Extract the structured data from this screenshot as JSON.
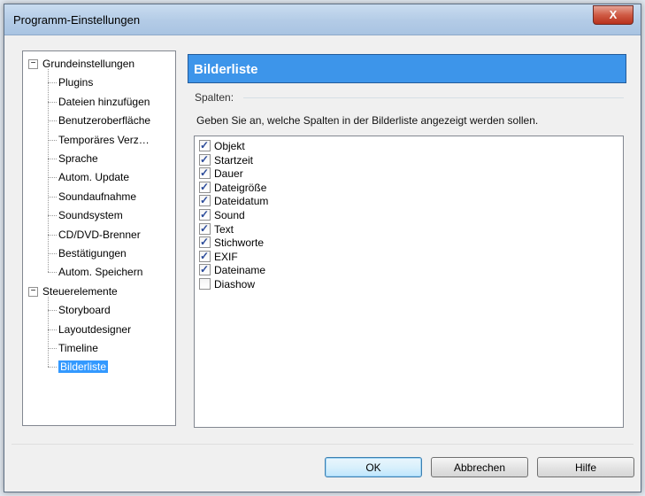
{
  "window": {
    "title": "Programm-Einstellungen",
    "close_glyph": "X"
  },
  "tree": {
    "items": [
      {
        "label": "Grundeinstellungen",
        "level": 0,
        "expander": "−",
        "selected": false
      },
      {
        "label": "Plugins",
        "level": 1,
        "selected": false
      },
      {
        "label": "Dateien hinzufügen",
        "level": 1,
        "selected": false
      },
      {
        "label": "Benutzeroberfläche",
        "level": 1,
        "selected": false
      },
      {
        "label": "Temporäres Verz…",
        "level": 1,
        "selected": false
      },
      {
        "label": "Sprache",
        "level": 1,
        "selected": false
      },
      {
        "label": "Autom. Update",
        "level": 1,
        "selected": false
      },
      {
        "label": "Soundaufnahme",
        "level": 1,
        "selected": false
      },
      {
        "label": "Soundsystem",
        "level": 1,
        "selected": false
      },
      {
        "label": "CD/DVD-Brenner",
        "level": 1,
        "selected": false
      },
      {
        "label": "Bestätigungen",
        "level": 1,
        "selected": false
      },
      {
        "label": "Autom. Speichern",
        "level": 1,
        "selected": false
      },
      {
        "label": "Steuerelemente",
        "level": 0,
        "expander": "−",
        "selected": false
      },
      {
        "label": "Storyboard",
        "level": 1,
        "selected": false
      },
      {
        "label": "Layoutdesigner",
        "level": 1,
        "selected": false
      },
      {
        "label": "Timeline",
        "level": 1,
        "selected": false
      },
      {
        "label": "Bilderliste",
        "level": 1,
        "selected": true
      }
    ]
  },
  "panel": {
    "header": "Bilderliste",
    "group_label": "Spalten:",
    "description": "Geben Sie an, welche Spalten in der Bilderliste angezeigt werden sollen."
  },
  "columns": [
    {
      "label": "Objekt",
      "checked": true
    },
    {
      "label": "Startzeit",
      "checked": true
    },
    {
      "label": "Dauer",
      "checked": true
    },
    {
      "label": "Dateigröße",
      "checked": true
    },
    {
      "label": "Dateidatum",
      "checked": true
    },
    {
      "label": "Sound",
      "checked": true
    },
    {
      "label": "Text",
      "checked": true
    },
    {
      "label": "Stichworte",
      "checked": true
    },
    {
      "label": "EXIF",
      "checked": true
    },
    {
      "label": "Dateiname",
      "checked": true
    },
    {
      "label": "Diashow",
      "checked": false
    }
  ],
  "buttons": {
    "ok": "OK",
    "cancel": "Abbrechen",
    "help": "Hilfe"
  },
  "colors": {
    "header_bg": "#3d95ea",
    "selection_bg": "#3399ff",
    "close_button": "#cf5a44"
  }
}
